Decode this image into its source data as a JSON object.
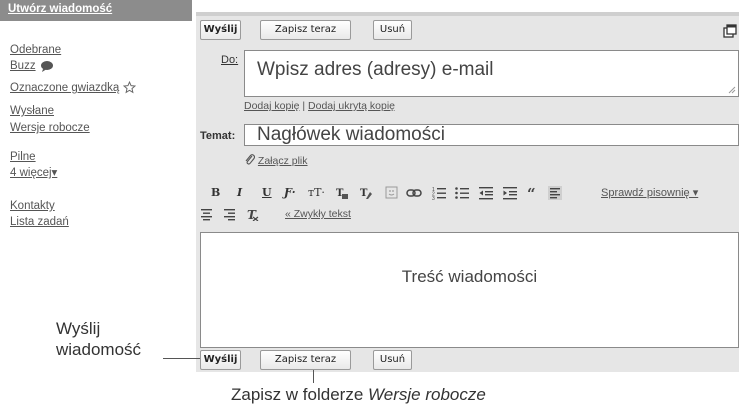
{
  "sidebar": {
    "compose_label": "Utwórz wiadomość",
    "items": [
      {
        "label": "Odebrane"
      },
      {
        "label": "Buzz",
        "icon": "buzz-icon"
      },
      {
        "label": "Oznaczone gwiazdką",
        "icon": "star-icon"
      },
      {
        "label": "Wysłane"
      },
      {
        "label": "Wersje robocze"
      },
      {
        "label": "Pilne"
      },
      {
        "label": "4 więcej▾"
      },
      {
        "label": "Kontakty"
      },
      {
        "label": "Lista zadań"
      }
    ]
  },
  "compose": {
    "top_buttons": {
      "send": "Wyślij",
      "save": "Zapisz teraz",
      "discard": "Usuń"
    },
    "to_label": "Do:",
    "to_placeholder": "Wpisz adres (adresy) e-mail",
    "add_cc": "Dodaj kopię",
    "separator": "|",
    "add_bcc": "Dodaj ukrytą kopię",
    "subject_label": "Temat:",
    "subject_placeholder": "Nagłówek wiadomości",
    "attach": "Załącz plik",
    "toolbar": {
      "bold": "B",
      "italic": "I",
      "underline": "U",
      "font": "Ƒ·",
      "size": "тT·",
      "spellcheck": "Sprawdź pisownię ▾",
      "plain_text": "« Zwykły tekst"
    },
    "body_placeholder": "Treść wiadomości",
    "bottom_buttons": {
      "send": "Wyślij",
      "save": "Zapisz teraz",
      "discard": "Usuń"
    }
  },
  "annotations": {
    "send_line1": "Wyślij",
    "send_line2": "wiadomość",
    "save_prefix": "Zapisz w folderze",
    "save_folder": "Wersje robocze"
  }
}
